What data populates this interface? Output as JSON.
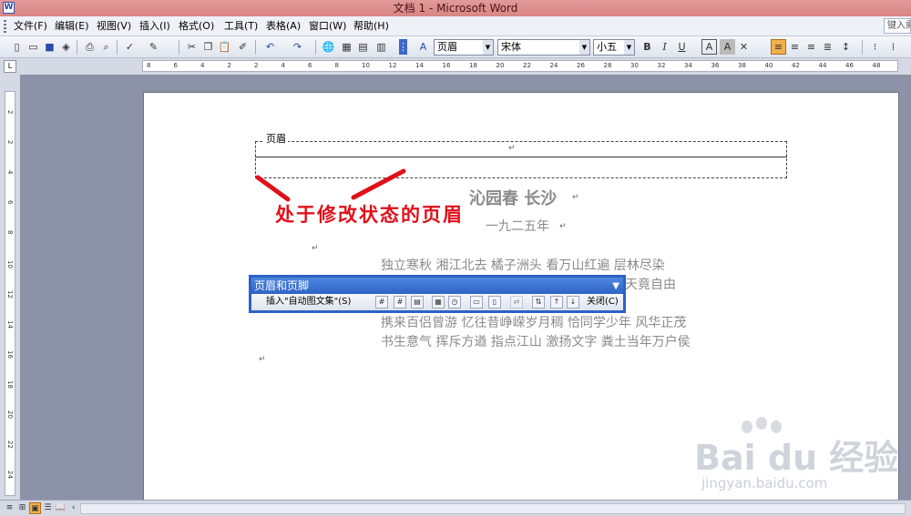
{
  "window": {
    "title": "文档 1 - Microsoft Word"
  },
  "menu": {
    "items": [
      "文件(F)",
      "编辑(E)",
      "视图(V)",
      "插入(I)",
      "格式(O)",
      "工具(T)",
      "表格(A)",
      "窗口(W)",
      "帮助(H)"
    ],
    "help_placeholder": "键入需"
  },
  "toolbar": {
    "style": "页眉",
    "font": "宋体",
    "size": "小五",
    "bold": "B",
    "italic": "I",
    "underline": "U",
    "font_color": "A",
    "highlight": "A"
  },
  "ruler": {
    "h_ticks": [
      "8",
      "6",
      "4",
      "2",
      "2",
      "4",
      "6",
      "8",
      "10",
      "12",
      "14",
      "16",
      "18",
      "20",
      "22",
      "24",
      "26",
      "28",
      "30",
      "32",
      "34",
      "36",
      "38",
      "40",
      "42",
      "44",
      "46",
      "48"
    ],
    "v_ticks": [
      "2",
      "2",
      "4",
      "6",
      "8",
      "10",
      "12",
      "14",
      "16",
      "18",
      "20",
      "22",
      "24"
    ],
    "corner": "L"
  },
  "document": {
    "header_label": "页眉",
    "annotation": "处于修改状态的页眉",
    "title": "沁园春  长沙",
    "date": "一九二五年",
    "lines": [
      "独立寒秋  湘江北去  橘子洲头  看万山红遍  层林尽染",
      "天竟自由",
      "携来百侣曾游  忆往昔峥嵘岁月稠  恰同学少年  风华正茂",
      "书生意气  挥斥方遒  指点江山  激扬文字  粪土当年万户侯"
    ],
    "para_mark": "↵"
  },
  "hf_toolbar": {
    "title": "页眉和页脚",
    "insert_autotext": "插入\"自动图文集\"(S)",
    "close": "关闭(C)"
  },
  "watermark": {
    "logo": "Bai du 经验",
    "url": "jingyan.baidu.com"
  }
}
